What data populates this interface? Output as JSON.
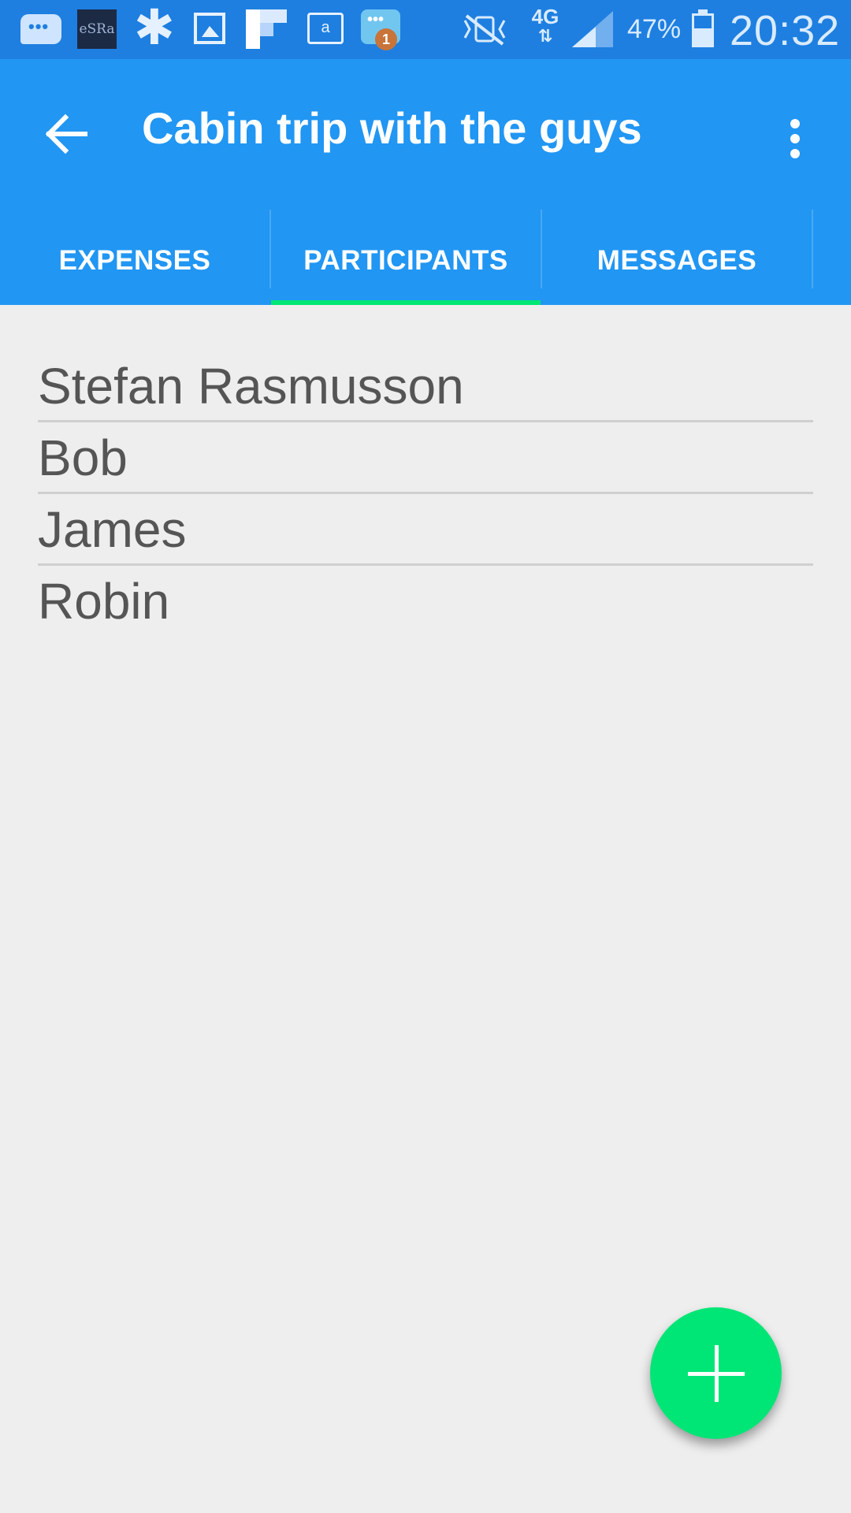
{
  "status_bar": {
    "esra_badge": "eSRa",
    "kindle_glyph": "a",
    "chat_badge_count": "1",
    "network": "4G",
    "battery_percent": "47%",
    "time": "20:32",
    "icons": [
      "message-icon",
      "esra-app-icon",
      "asterisk-app-icon",
      "gallery-icon",
      "flipboard-icon",
      "kindle-icon",
      "chat-icon",
      "mute-vibrate-icon",
      "network-4g-icon",
      "signal-icon",
      "battery-icon"
    ]
  },
  "app_bar": {
    "title": "Cabin trip with the guys",
    "back_icon": "arrow-left-icon",
    "overflow_icon": "more-vert-icon",
    "color": "#2196f3"
  },
  "tabs": [
    {
      "label": "EXPENSES",
      "selected": false
    },
    {
      "label": "PARTICIPANTS",
      "selected": true
    },
    {
      "label": "MESSAGES",
      "selected": false
    }
  ],
  "tab_indicator_color": "#00e676",
  "participants": [
    {
      "name": "Stefan Rasmusson"
    },
    {
      "name": "Bob"
    },
    {
      "name": "James"
    },
    {
      "name": "Robin"
    }
  ],
  "fab": {
    "icon": "plus-icon",
    "color": "#00e676"
  }
}
